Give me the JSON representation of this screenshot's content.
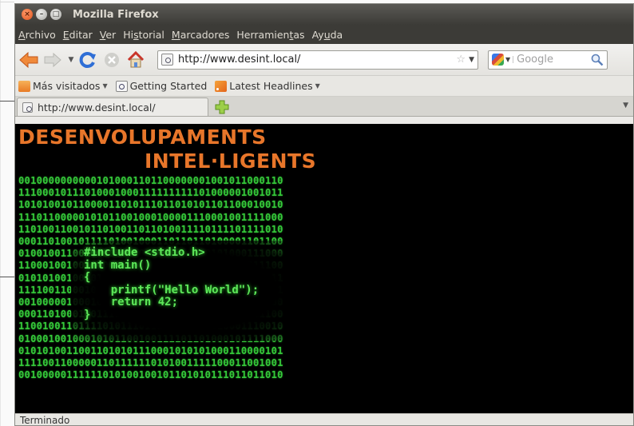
{
  "window": {
    "title": "Mozilla Firefox"
  },
  "menubar": {
    "items": [
      {
        "accel": "A",
        "rest": "rchivo"
      },
      {
        "accel": "E",
        "rest": "ditar"
      },
      {
        "accel": "V",
        "rest": "er"
      },
      {
        "pre": "Hi",
        "accel": "s",
        "rest": "torial"
      },
      {
        "accel": "M",
        "rest": "arcadores"
      },
      {
        "pre": "Herramien",
        "accel": "t",
        "rest": "as"
      },
      {
        "pre": "Ay",
        "accel": "u",
        "rest": "da"
      }
    ]
  },
  "navbar": {
    "url": "http://www.desint.local/",
    "search_placeholder": "Google",
    "icons": [
      "back-arrow-icon",
      "forward-arrow-icon",
      "history-dropdown-icon",
      "reload-icon",
      "stop-icon",
      "home-icon"
    ]
  },
  "bookmarks": {
    "items": [
      {
        "label": "Más visitados",
        "dropdown": true,
        "icon": "folder-icon"
      },
      {
        "label": "Getting Started",
        "dropdown": false,
        "icon": "page-icon"
      },
      {
        "label": "Latest Headlines",
        "dropdown": true,
        "icon": "rss-icon"
      }
    ]
  },
  "tabs": [
    {
      "label": "http://www.desint.local/"
    }
  ],
  "content": {
    "logo_line1": "DESENVOLUPAMENTS",
    "logo_line2": "INTEL·LIGENTS",
    "brand_color": "#e8762a",
    "binary_color": "#35c93a",
    "binary_rows": [
      "00100000000001010001101100000001001011000110",
      "11100010111010001000111111111101000001001011",
      "10101001011000011010111011010101101100010010",
      "11101100000101011001000100001110001001111000",
      "11010011001011010011011010011110111101111010",
      "00011010010111101001000110110110100001101100",
      "01001001100100101001000101000100101000111000",
      "11000100100101001110010001000100100001011100",
      "01010100100101001010010001001001000110001011",
      "11110011000101001000101001010000100110010001",
      "00100000100010111100101011101000010111101100",
      "00011010001001111101100101101110100001101100",
      "11001001101111010111011110000001010001110010",
      "01000100100010101100100111101101000101111000",
      "01010100110011010101110001010101000110000101",
      "11110011000001101111110101001111100011001001",
      "00100000111111010100100101101010111011011010"
    ],
    "code_lines": [
      "#include <stdio.h>",
      "int main()",
      "{",
      "    printf(\"Hello World\");",
      "    return 42;",
      "}"
    ]
  },
  "statusbar": {
    "text": "Terminado"
  }
}
